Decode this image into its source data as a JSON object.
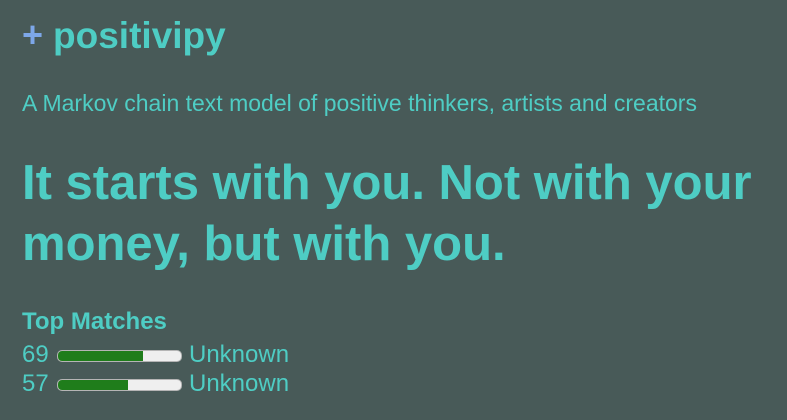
{
  "header": {
    "plus_symbol": "+",
    "app_title": "positivipy"
  },
  "tagline": "A Markov chain text model of positive thinkers, artists and creators",
  "quote": "It starts with you. Not with your money, but with you.",
  "top_matches": {
    "heading": "Top Matches",
    "items": [
      {
        "score": "69",
        "percent": 69,
        "label": "Unknown"
      },
      {
        "score": "57",
        "percent": 57,
        "label": "Unknown"
      }
    ]
  },
  "colors": {
    "background": "#485a58",
    "text": "#4ecdc4",
    "plus": "#7da7e8",
    "bar_fill": "#1f7d1b",
    "bar_track": "#efefef"
  }
}
